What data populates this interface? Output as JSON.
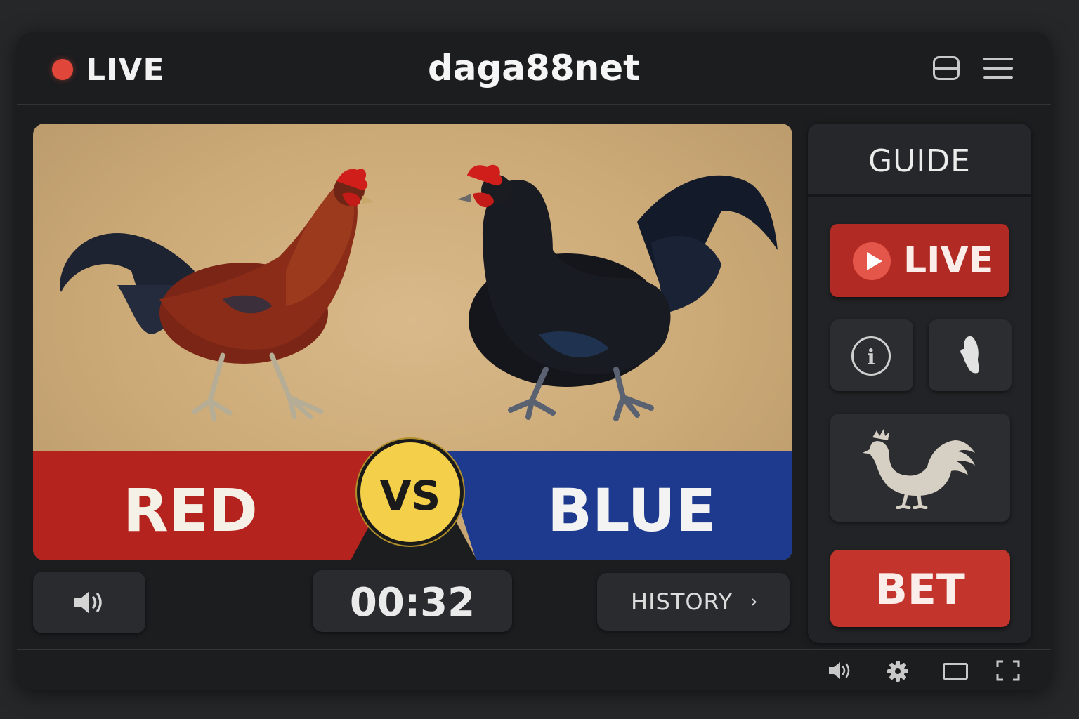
{
  "header": {
    "live_label": "LIVE",
    "brand": "daga88net",
    "icons": [
      "window-icon",
      "menu-icon"
    ]
  },
  "match": {
    "red_label": "RED",
    "vs_label": "VS",
    "blue_label": "BLUE"
  },
  "controls": {
    "timer": "00:32",
    "history_label": "HISTORY",
    "history_caret": "›"
  },
  "side": {
    "guide_label": "GUIDE",
    "live_button_label": "LIVE",
    "info_glyph": "i",
    "bet_label": "BET"
  },
  "bottom_icons": [
    "volume-icon",
    "settings-icon",
    "theater-mode-icon",
    "fullscreen-icon"
  ],
  "colors": {
    "live_dot": "#e0473a",
    "red_side": "#b5231f",
    "blue_side": "#1e3a8e",
    "vs_badge": "#f4cf4a",
    "bet_button": "#c2342c"
  }
}
